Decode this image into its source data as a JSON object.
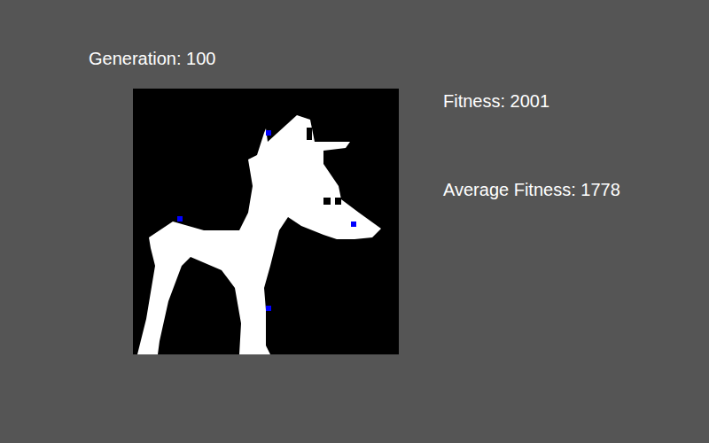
{
  "generation": {
    "label": "Generation: 100"
  },
  "stats": [
    {
      "label": "Fitness: 2001"
    },
    {
      "label": "Average Fitness: 1778"
    }
  ]
}
